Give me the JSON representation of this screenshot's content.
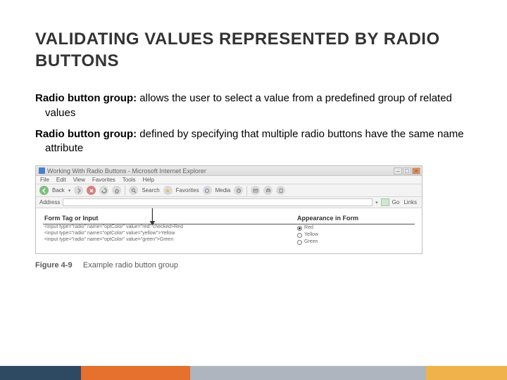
{
  "title": "VALIDATING VALUES REPRESENTED BY RADIO BUTTONS",
  "paragraphs": {
    "p1_label": "Radio button group: ",
    "p1_text": "allows the user to select a value from a predefined group of related values",
    "p2_label": "Radio button group: ",
    "p2_text": "defined by specifying that multiple radio buttons have the same name attribute"
  },
  "figure": {
    "number": "Figure 4-9",
    "caption_text": "Example radio button group",
    "window_title": "Working With Radio Buttons - Microsoft Internet Explorer",
    "menu": [
      "File",
      "Edit",
      "View",
      "Favorites",
      "Tools",
      "Help"
    ],
    "toolbar_labels": {
      "back": "Back",
      "search": "Search",
      "favorites": "Favorites",
      "media": "Media"
    },
    "addressbar": {
      "label": "Address",
      "go": "Go",
      "links": "Links"
    },
    "table": {
      "col1": "Form Tag or Input",
      "col2": "Appearance in Form",
      "code": [
        "<input type=\"radio\" name=\"optColor\" value=\"red\" checked>Red",
        "<input type=\"radio\" name=\"optColor\" value=\"yellow\">Yellow",
        "<input type=\"radio\" name=\"optColor\" value=\"green\">Green"
      ],
      "options": [
        "Red",
        "Yellow",
        "Green"
      ]
    }
  }
}
